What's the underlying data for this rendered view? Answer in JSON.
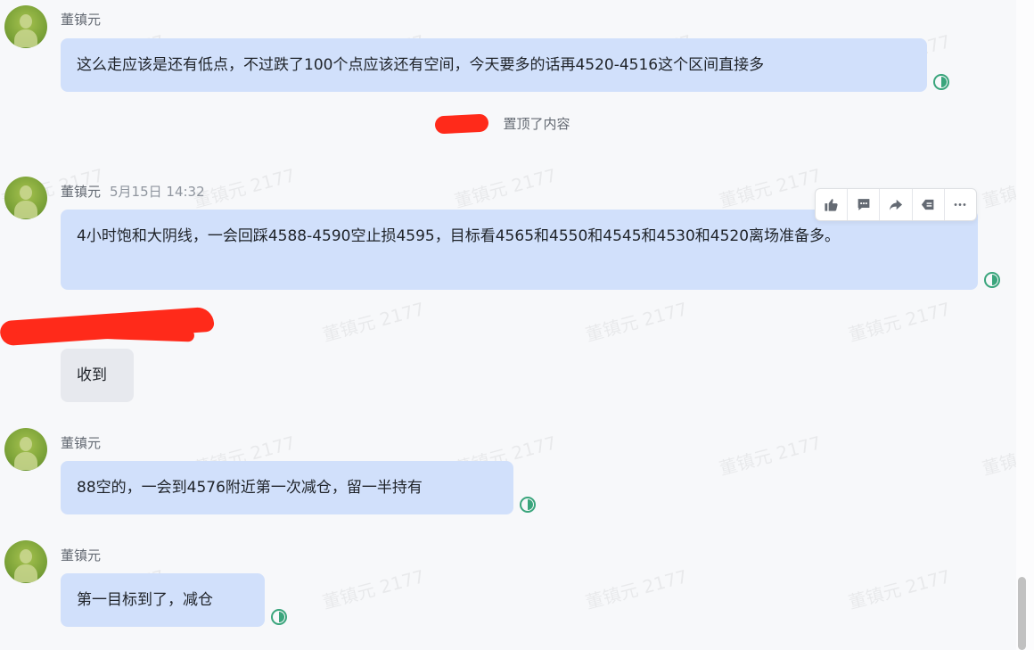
{
  "messages": [
    {
      "sender": "董镇元",
      "time": "",
      "text": "这么走应该是还有低点，不过跌了100个点应该还有空间，今天要多的话再4520-4516这个区间直接多"
    },
    {
      "sender": "董镇元",
      "time": "5月15日 14:32",
      "text": "4小时饱和大阴线，一会回踩4588-4590空止损4595，目标看4565和4550和4545和4530和4520离场准备多。"
    },
    {
      "sender": "",
      "time": "",
      "text": "收到"
    },
    {
      "sender": "董镇元",
      "time": "",
      "text": "88空的，一会到4576附近第一次减仓，留一半持有"
    },
    {
      "sender": "董镇元",
      "time": "",
      "text": "第一目标到了，减仓"
    }
  ],
  "system_notice": {
    "action": "置顶了内容"
  },
  "toolbar": {
    "icons": [
      "thumbs-up-icon",
      "comment-icon",
      "forward-icon",
      "tag-icon",
      "more-icon"
    ]
  },
  "watermark": "董镇元 2177",
  "colors": {
    "bubble_self": "#d1e0fb",
    "bubble_other": "#e7e9ee",
    "read_status": "#3aa57c",
    "redaction": "#ff2a1a"
  }
}
